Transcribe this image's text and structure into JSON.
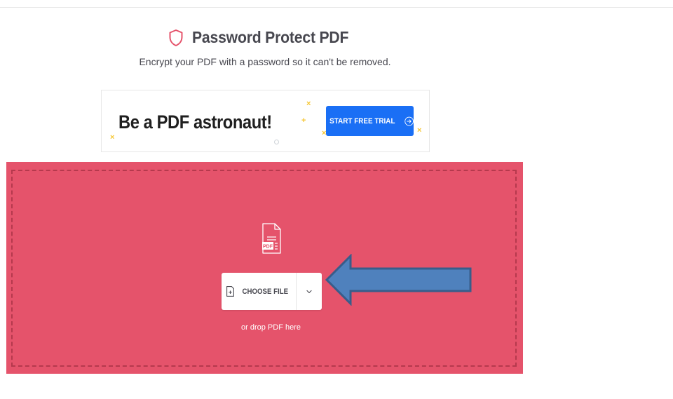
{
  "header": {
    "title": "Password Protect PDF",
    "subtitle": "Encrypt your PDF with a password so it can't be removed.",
    "title_icon": "shield-icon"
  },
  "ad": {
    "headline": "Be a PDF astronaut!",
    "button_label": "START FREE TRIAL",
    "button_icon": "arrow-right-circle-icon",
    "accent_color": "#1a6ff5",
    "spark_color": "#f6c631"
  },
  "upload": {
    "background_color": "#e5536b",
    "file_icon": "pdf-file-icon",
    "file_icon_label": "PDF",
    "choose_file_label": "CHOOSE FILE",
    "choose_file_icon": "file-add-icon",
    "dropdown_icon": "chevron-down-icon",
    "drop_hint": "or drop PDF here"
  },
  "annotation": {
    "shape": "arrow-pointing-left",
    "fill_color": "#4f81bd",
    "stroke_color": "#385d8a"
  }
}
